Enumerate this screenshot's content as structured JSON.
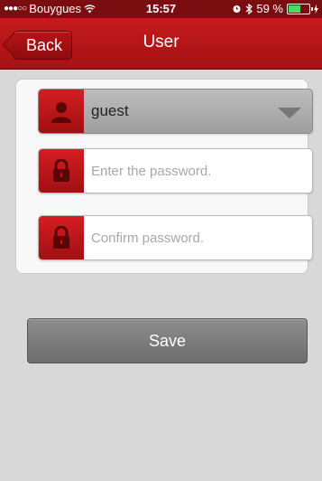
{
  "status_bar": {
    "signal_dots": "●●●○○",
    "carrier": "Bouygues",
    "time": "15:57",
    "battery_percent": "59 %",
    "battery_level": 0.59
  },
  "nav": {
    "back_label": "Back",
    "title": "User"
  },
  "form": {
    "user_select_value": "guest",
    "password_placeholder": "Enter the password.",
    "confirm_placeholder": "Confirm password."
  },
  "actions": {
    "save_label": "Save"
  },
  "colors": {
    "accent": "#c61a1d",
    "battery": "#4cd964"
  }
}
